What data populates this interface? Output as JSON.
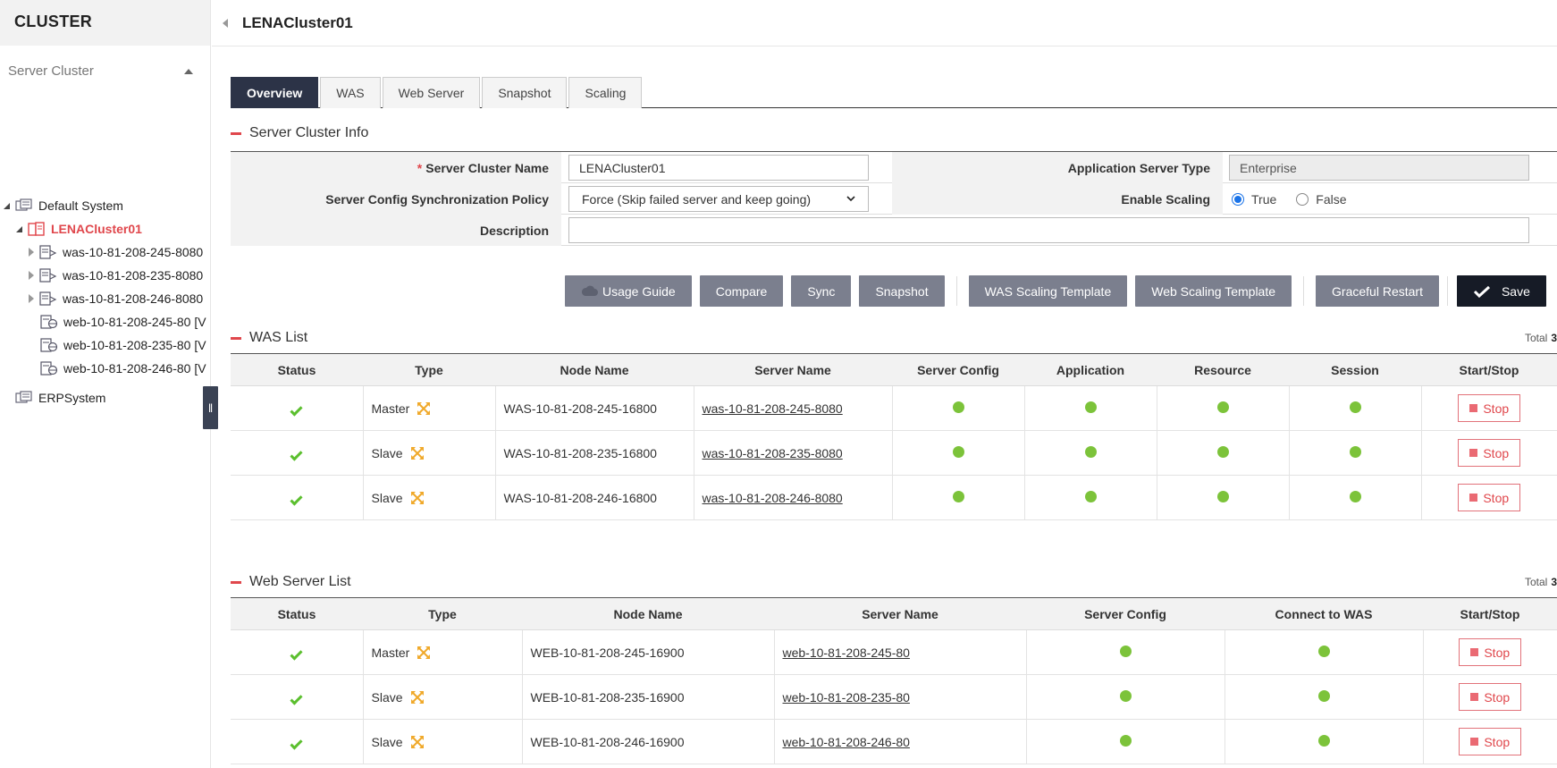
{
  "sidebar": {
    "title": "CLUSTER",
    "section": "Server Cluster",
    "tree": [
      {
        "label": "Default System",
        "level": 0,
        "state": "open",
        "icon": "system-icon"
      },
      {
        "label": "LENACluster01",
        "level": 1,
        "state": "open",
        "icon": "cluster-icon",
        "selected": true
      },
      {
        "label": "was-10-81-208-245-8080",
        "level": 2,
        "state": "closed",
        "icon": "was-server-icon"
      },
      {
        "label": "was-10-81-208-235-8080",
        "level": 2,
        "state": "closed",
        "icon": "was-server-icon"
      },
      {
        "label": "was-10-81-208-246-8080",
        "level": 2,
        "state": "closed",
        "icon": "was-server-icon"
      },
      {
        "label": "web-10-81-208-245-80 [V",
        "level": 2,
        "state": "leaf",
        "icon": "web-server-icon"
      },
      {
        "label": "web-10-81-208-235-80 [V",
        "level": 2,
        "state": "leaf",
        "icon": "web-server-icon"
      },
      {
        "label": "web-10-81-208-246-80 [V",
        "level": 2,
        "state": "leaf",
        "icon": "web-server-icon"
      },
      {
        "label": "ERPSystem",
        "level": 0,
        "state": "none",
        "icon": "system-icon"
      }
    ],
    "collapse_glyph": "‖"
  },
  "header": {
    "title": "LENACluster01"
  },
  "tabs": [
    "Overview",
    "WAS",
    "Web Server",
    "Snapshot",
    "Scaling"
  ],
  "info": {
    "section_title": "Server Cluster Info",
    "required_mark": "*",
    "name_label": "Server Cluster Name",
    "name_value": "LENACluster01",
    "app_type_label": "Application Server Type",
    "app_type_value": "Enterprise",
    "sync_label": "Server Config Synchronization Policy",
    "sync_value": "Force (Skip failed server and keep going)",
    "scaling_label": "Enable Scaling",
    "scaling_true": "True",
    "scaling_false": "False",
    "description_label": "Description",
    "description_value": ""
  },
  "buttons": {
    "usage_guide": "Usage Guide",
    "compare": "Compare",
    "sync": "Sync",
    "snapshot": "Snapshot",
    "was_scaling": "WAS Scaling Template",
    "web_scaling": "Web Scaling Template",
    "graceful_restart": "Graceful Restart",
    "save": "Save"
  },
  "was_list": {
    "title": "WAS List",
    "total_label": "Total",
    "total": "3",
    "columns": [
      "Status",
      "Type",
      "Node Name",
      "Server Name",
      "Server Config",
      "Application",
      "Resource",
      "Session",
      "Start/Stop"
    ],
    "rows": [
      {
        "type": "Master",
        "node": "WAS-10-81-208-245-16800",
        "server": "was-10-81-208-245-8080",
        "action": "Stop"
      },
      {
        "type": "Slave",
        "node": "WAS-10-81-208-235-16800",
        "server": "was-10-81-208-235-8080",
        "action": "Stop"
      },
      {
        "type": "Slave",
        "node": "WAS-10-81-208-246-16800",
        "server": "was-10-81-208-246-8080",
        "action": "Stop"
      }
    ]
  },
  "web_list": {
    "title": "Web Server List",
    "total_label": "Total",
    "total": "3",
    "columns": [
      "Status",
      "Type",
      "Node Name",
      "Server Name",
      "Server Config",
      "Connect to WAS",
      "Start/Stop"
    ],
    "rows": [
      {
        "type": "Master",
        "node": "WEB-10-81-208-245-16900",
        "server": "web-10-81-208-245-80",
        "action": "Stop"
      },
      {
        "type": "Slave",
        "node": "WEB-10-81-208-235-16900",
        "server": "web-10-81-208-235-80",
        "action": "Stop"
      },
      {
        "type": "Slave",
        "node": "WEB-10-81-208-246-16900",
        "server": "web-10-81-208-246-80",
        "action": "Stop"
      }
    ]
  },
  "colors": {
    "accent_red": "#e0474c",
    "active_tab": "#2c3347",
    "button_gray": "#7b7f8e",
    "status_green": "#7cc33a",
    "scale_orange": "#f0a92a"
  }
}
